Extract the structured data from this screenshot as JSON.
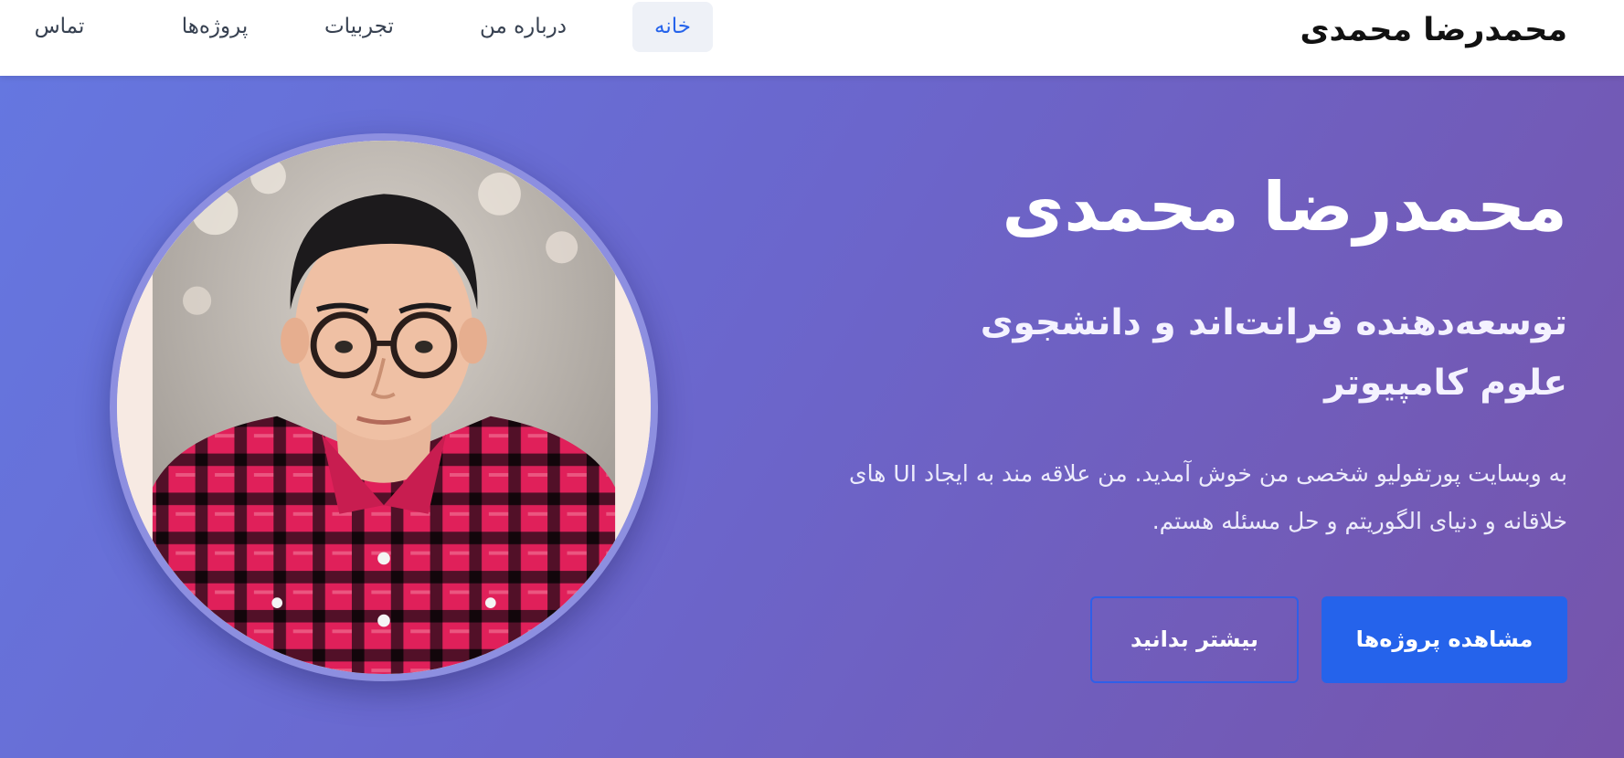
{
  "header": {
    "brand": "محمدرضا محمدی",
    "nav": [
      {
        "label": "خانه",
        "active": true
      },
      {
        "label": "درباره من",
        "active": false
      },
      {
        "label": "تجربیات",
        "active": false
      },
      {
        "label": "پروژه‌ها",
        "active": false
      },
      {
        "label": "تماس",
        "active": false
      }
    ]
  },
  "hero": {
    "name": "محمدرضا محمدی",
    "title": "توسعه‌دهنده فرانت‌اند و دانشجوی علوم کامپیوتر",
    "intro": "به وبسایت پورتفولیو شخصی من خوش آمدید. من علاقه مند به ایجاد UI های خلاقانه و دنیای الگوریتم و حل مسئله هستم.",
    "primary_button": "مشاهده پروژه‌ها",
    "secondary_button": "بیشتر بدانید"
  },
  "colors": {
    "accent": "#2563eb",
    "hero_gradient_start": "#6577e0",
    "hero_gradient_end": "#7654ab",
    "nav_active_bg": "#eef1f7"
  }
}
